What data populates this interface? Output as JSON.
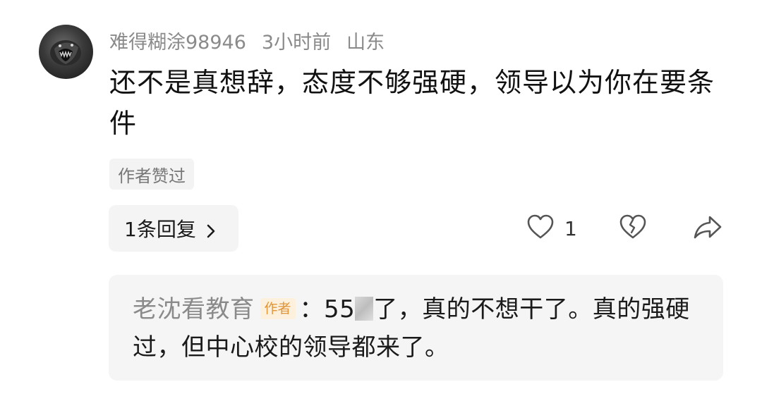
{
  "comment": {
    "username": "难得糊涂98946",
    "time": "3小时前",
    "location": "山东",
    "text": "还不是真想辞，态度不够强硬，领导以为你在要条件",
    "author_liked_badge": "作者赞过"
  },
  "actions": {
    "reply_count_label": "1条回复",
    "like_count": "1"
  },
  "reply": {
    "author_name": "老沈看教育",
    "author_tag": "作者",
    "text_before": "：55",
    "text_after": "了，真的不想干了。真的强硬过，但中心校的领导都来了。"
  },
  "icons": {
    "avatar": "avatar-image",
    "chevron": "chevron-right-icon",
    "like": "heart-outline-icon",
    "dislike": "broken-heart-icon",
    "share": "share-arrow-icon"
  },
  "colors": {
    "meta_text": "#8a8a8a",
    "author_tag_bg": "#fdf0dc",
    "author_tag_text": "#e0953a",
    "card_bg": "#f5f5f5"
  }
}
